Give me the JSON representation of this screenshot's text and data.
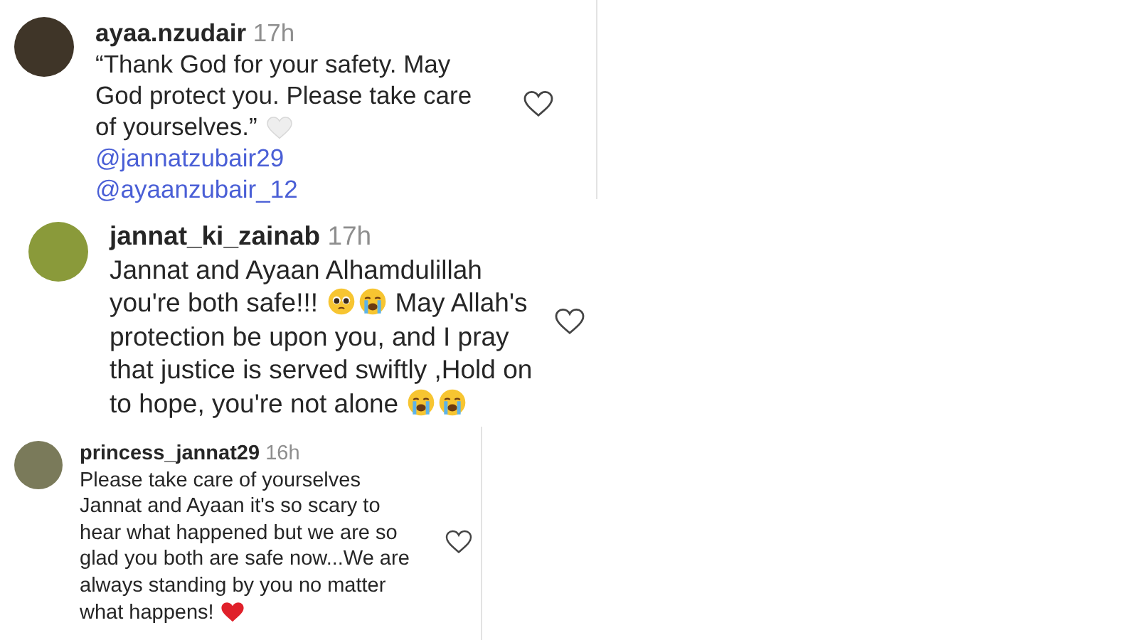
{
  "comments": [
    {
      "username": "ayaa.nzudair",
      "time": "17h",
      "liked": false,
      "body": [
        {
          "kind": "text",
          "text": "“Thank God for your safety. May God protect you. Please take care of yourselves.” "
        },
        {
          "kind": "white_heart"
        },
        {
          "kind": "mention",
          "text": "@jannatzubair29"
        },
        {
          "kind": "mention",
          "text": "@ayaanzubair_12"
        }
      ]
    },
    {
      "username": "jannat_ki_zainab",
      "time": "17h",
      "liked": false,
      "body": [
        {
          "kind": "text",
          "text": "Jannat and Ayaan Alhamdulillah you're both safe!!! "
        },
        {
          "kind": "pleading_face"
        },
        {
          "kind": "crying_face"
        },
        {
          "kind": "text",
          "text": " May Allah's protection be upon you, and I pray that justice is served swiftly ,Hold on to hope, you're not alone "
        },
        {
          "kind": "crying_face"
        },
        {
          "kind": "crying_face"
        }
      ]
    },
    {
      "username": "princess_jannat29",
      "time": "16h",
      "liked": false,
      "body": [
        {
          "kind": "text",
          "text": "Please take care of yourselves Jannat and Ayaan it's so scary to hear what happened but we are so glad you both are safe now...We are always standing by you no matter what happens! "
        },
        {
          "kind": "red_heart"
        }
      ]
    }
  ]
}
